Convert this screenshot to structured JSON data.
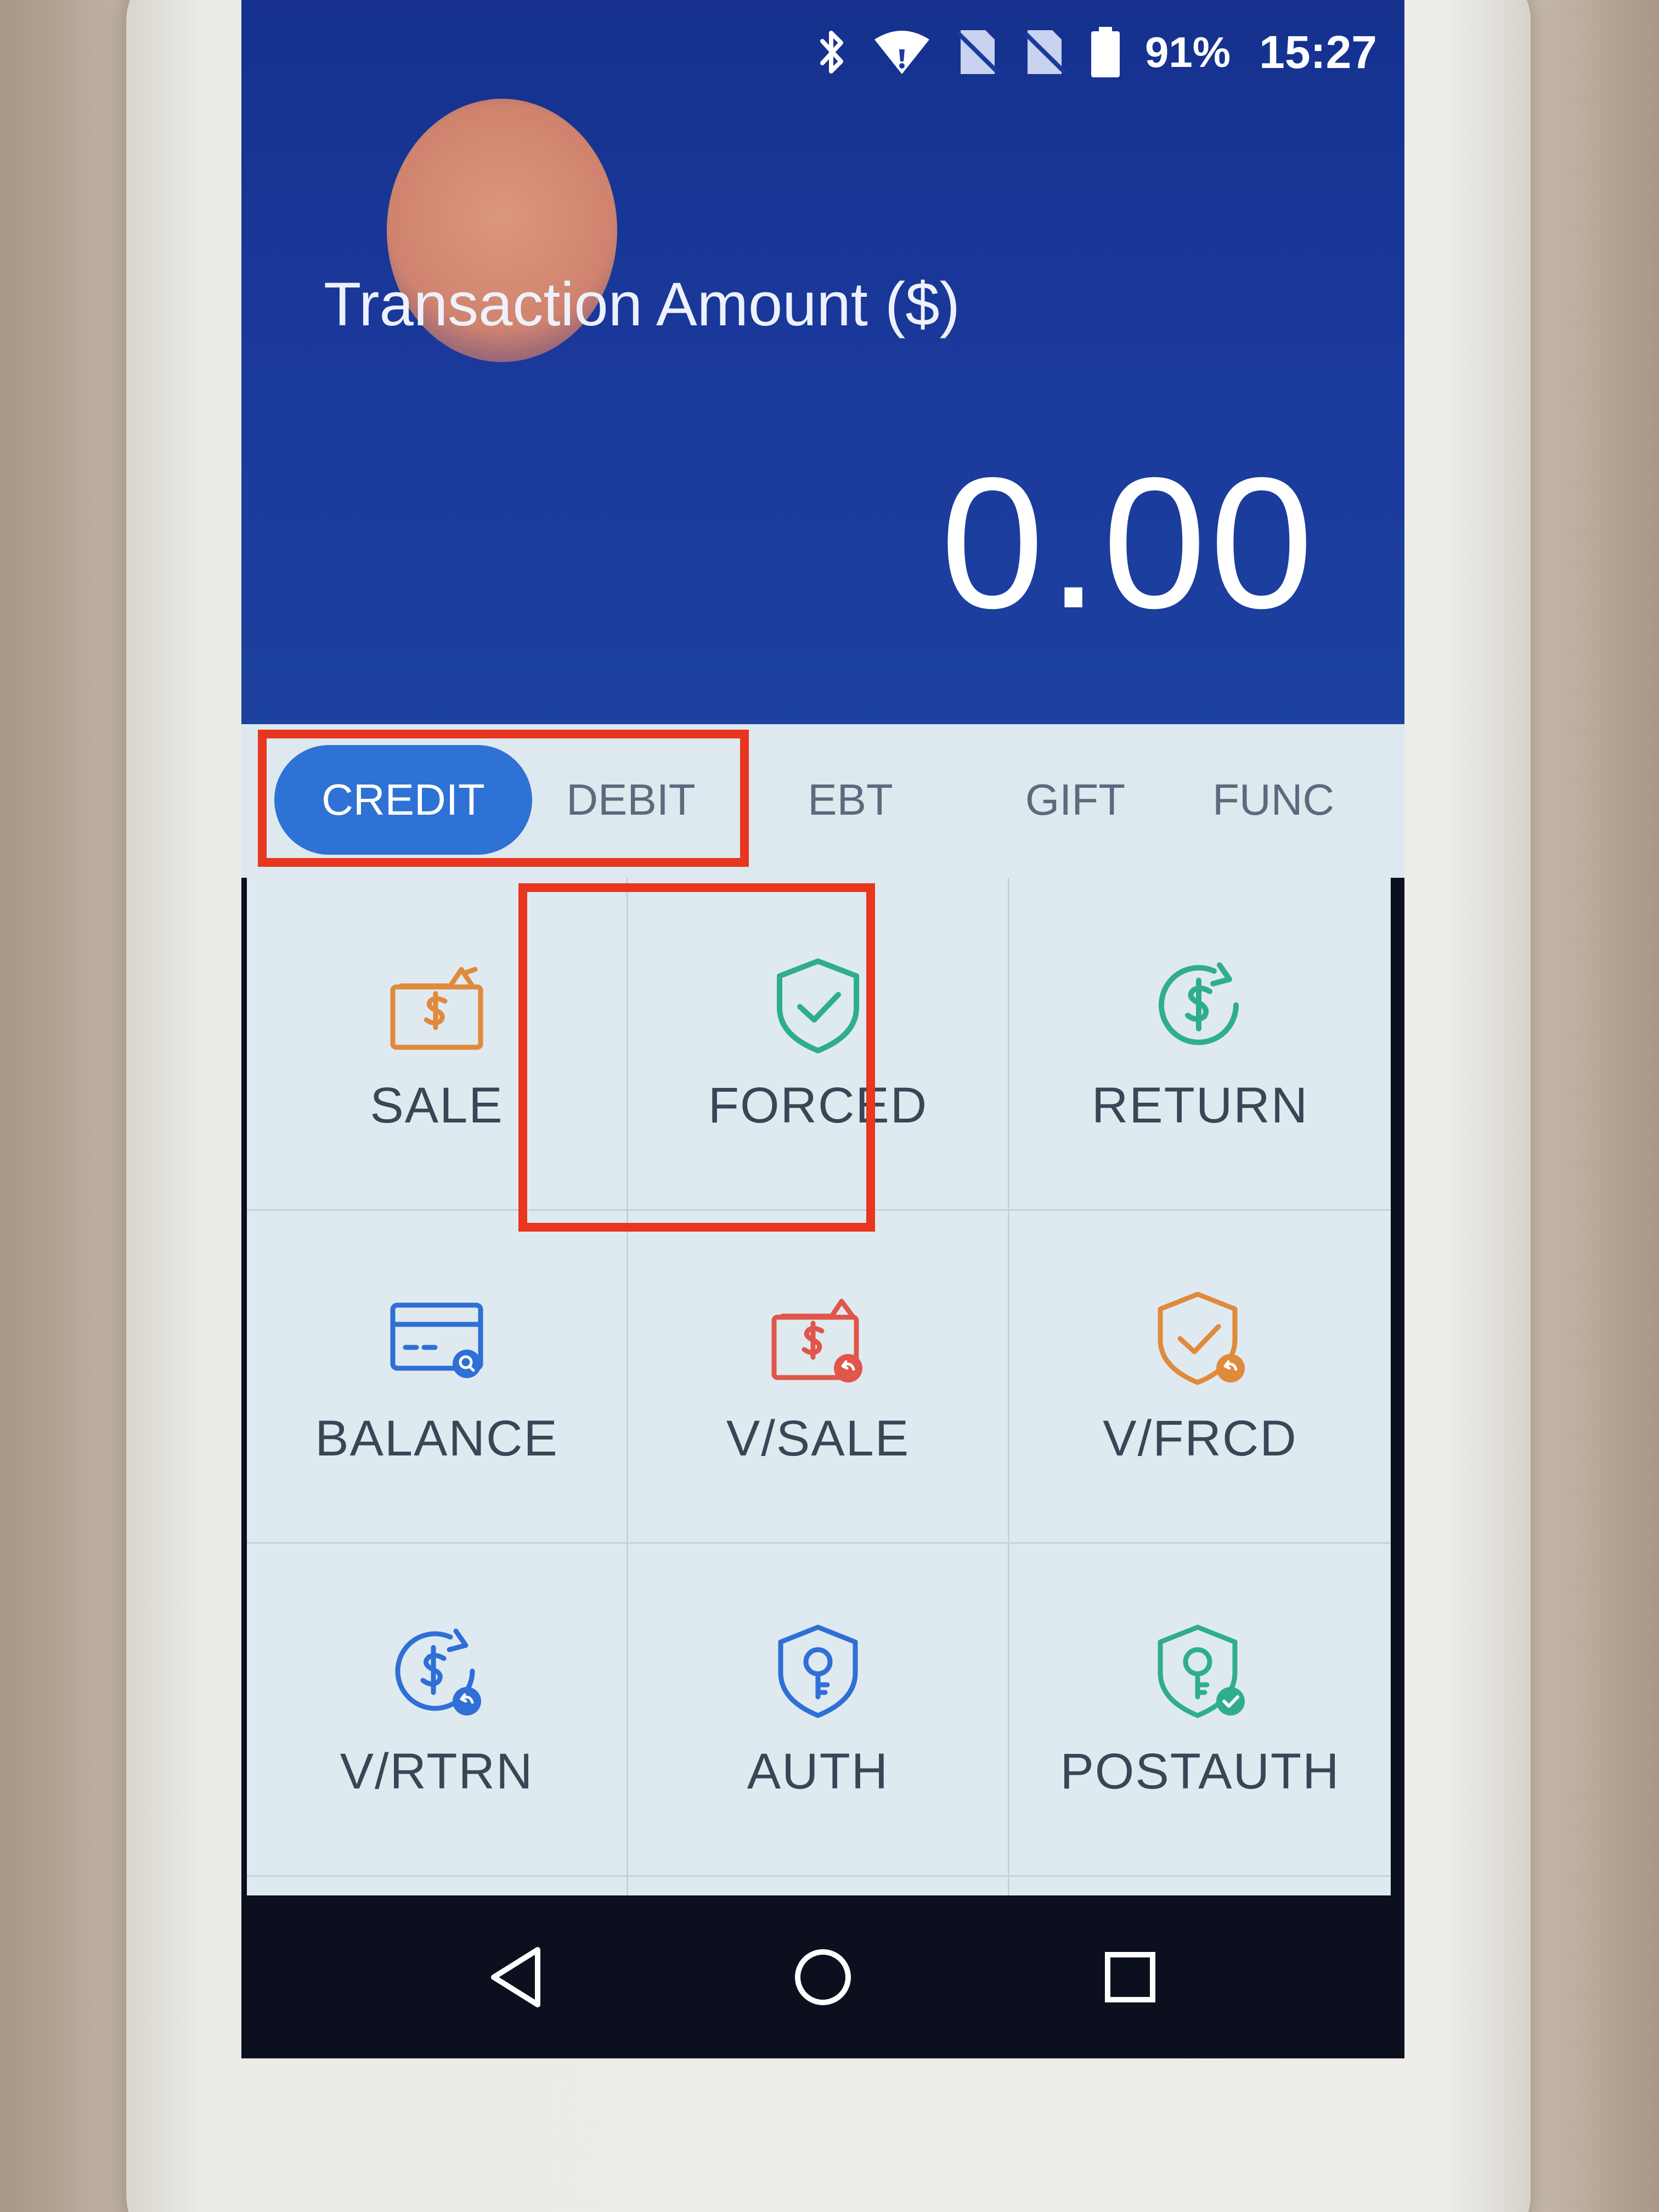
{
  "status_bar": {
    "icons": [
      "bluetooth-icon",
      "wifi-icon",
      "no-sim-icon",
      "no-sim-icon",
      "battery-icon"
    ],
    "battery": "91%",
    "time": "15:27"
  },
  "header": {
    "amount_label": "Transaction Amount ($)",
    "amount_value": "0.00"
  },
  "tabs": [
    {
      "label": "CREDIT",
      "active": true
    },
    {
      "label": "DEBIT",
      "active": false
    },
    {
      "label": "EBT",
      "active": false
    },
    {
      "label": "GIFT",
      "active": false
    },
    {
      "label": "FUNC",
      "active": false
    }
  ],
  "functions": [
    {
      "label": "SALE",
      "icon": "wallet-dollar-icon",
      "color": "#e08a3c"
    },
    {
      "label": "FORCED",
      "icon": "shield-check-icon",
      "color": "#2fae8e"
    },
    {
      "label": "RETURN",
      "icon": "dollar-refresh-icon",
      "color": "#2fae8e"
    },
    {
      "label": "BALANCE",
      "icon": "card-search-icon",
      "color": "#2f6fd6"
    },
    {
      "label": "V/SALE",
      "icon": "wallet-void-icon",
      "color": "#e0564a"
    },
    {
      "label": "V/FRCD",
      "icon": "shield-void-icon",
      "color": "#e08a3c"
    },
    {
      "label": "V/RTRN",
      "icon": "dollar-void-icon",
      "color": "#2f6fd6"
    },
    {
      "label": "AUTH",
      "icon": "shield-key-icon",
      "color": "#2f6fd6"
    },
    {
      "label": "POSTAUTH",
      "icon": "shield-key-check-icon",
      "color": "#2fae8e"
    }
  ],
  "nav": [
    "back-icon",
    "home-icon",
    "recents-icon"
  ],
  "colors": {
    "header_bg": "#1a3a9c",
    "active_tab": "#2f72d6",
    "highlight": "#e8361f"
  }
}
